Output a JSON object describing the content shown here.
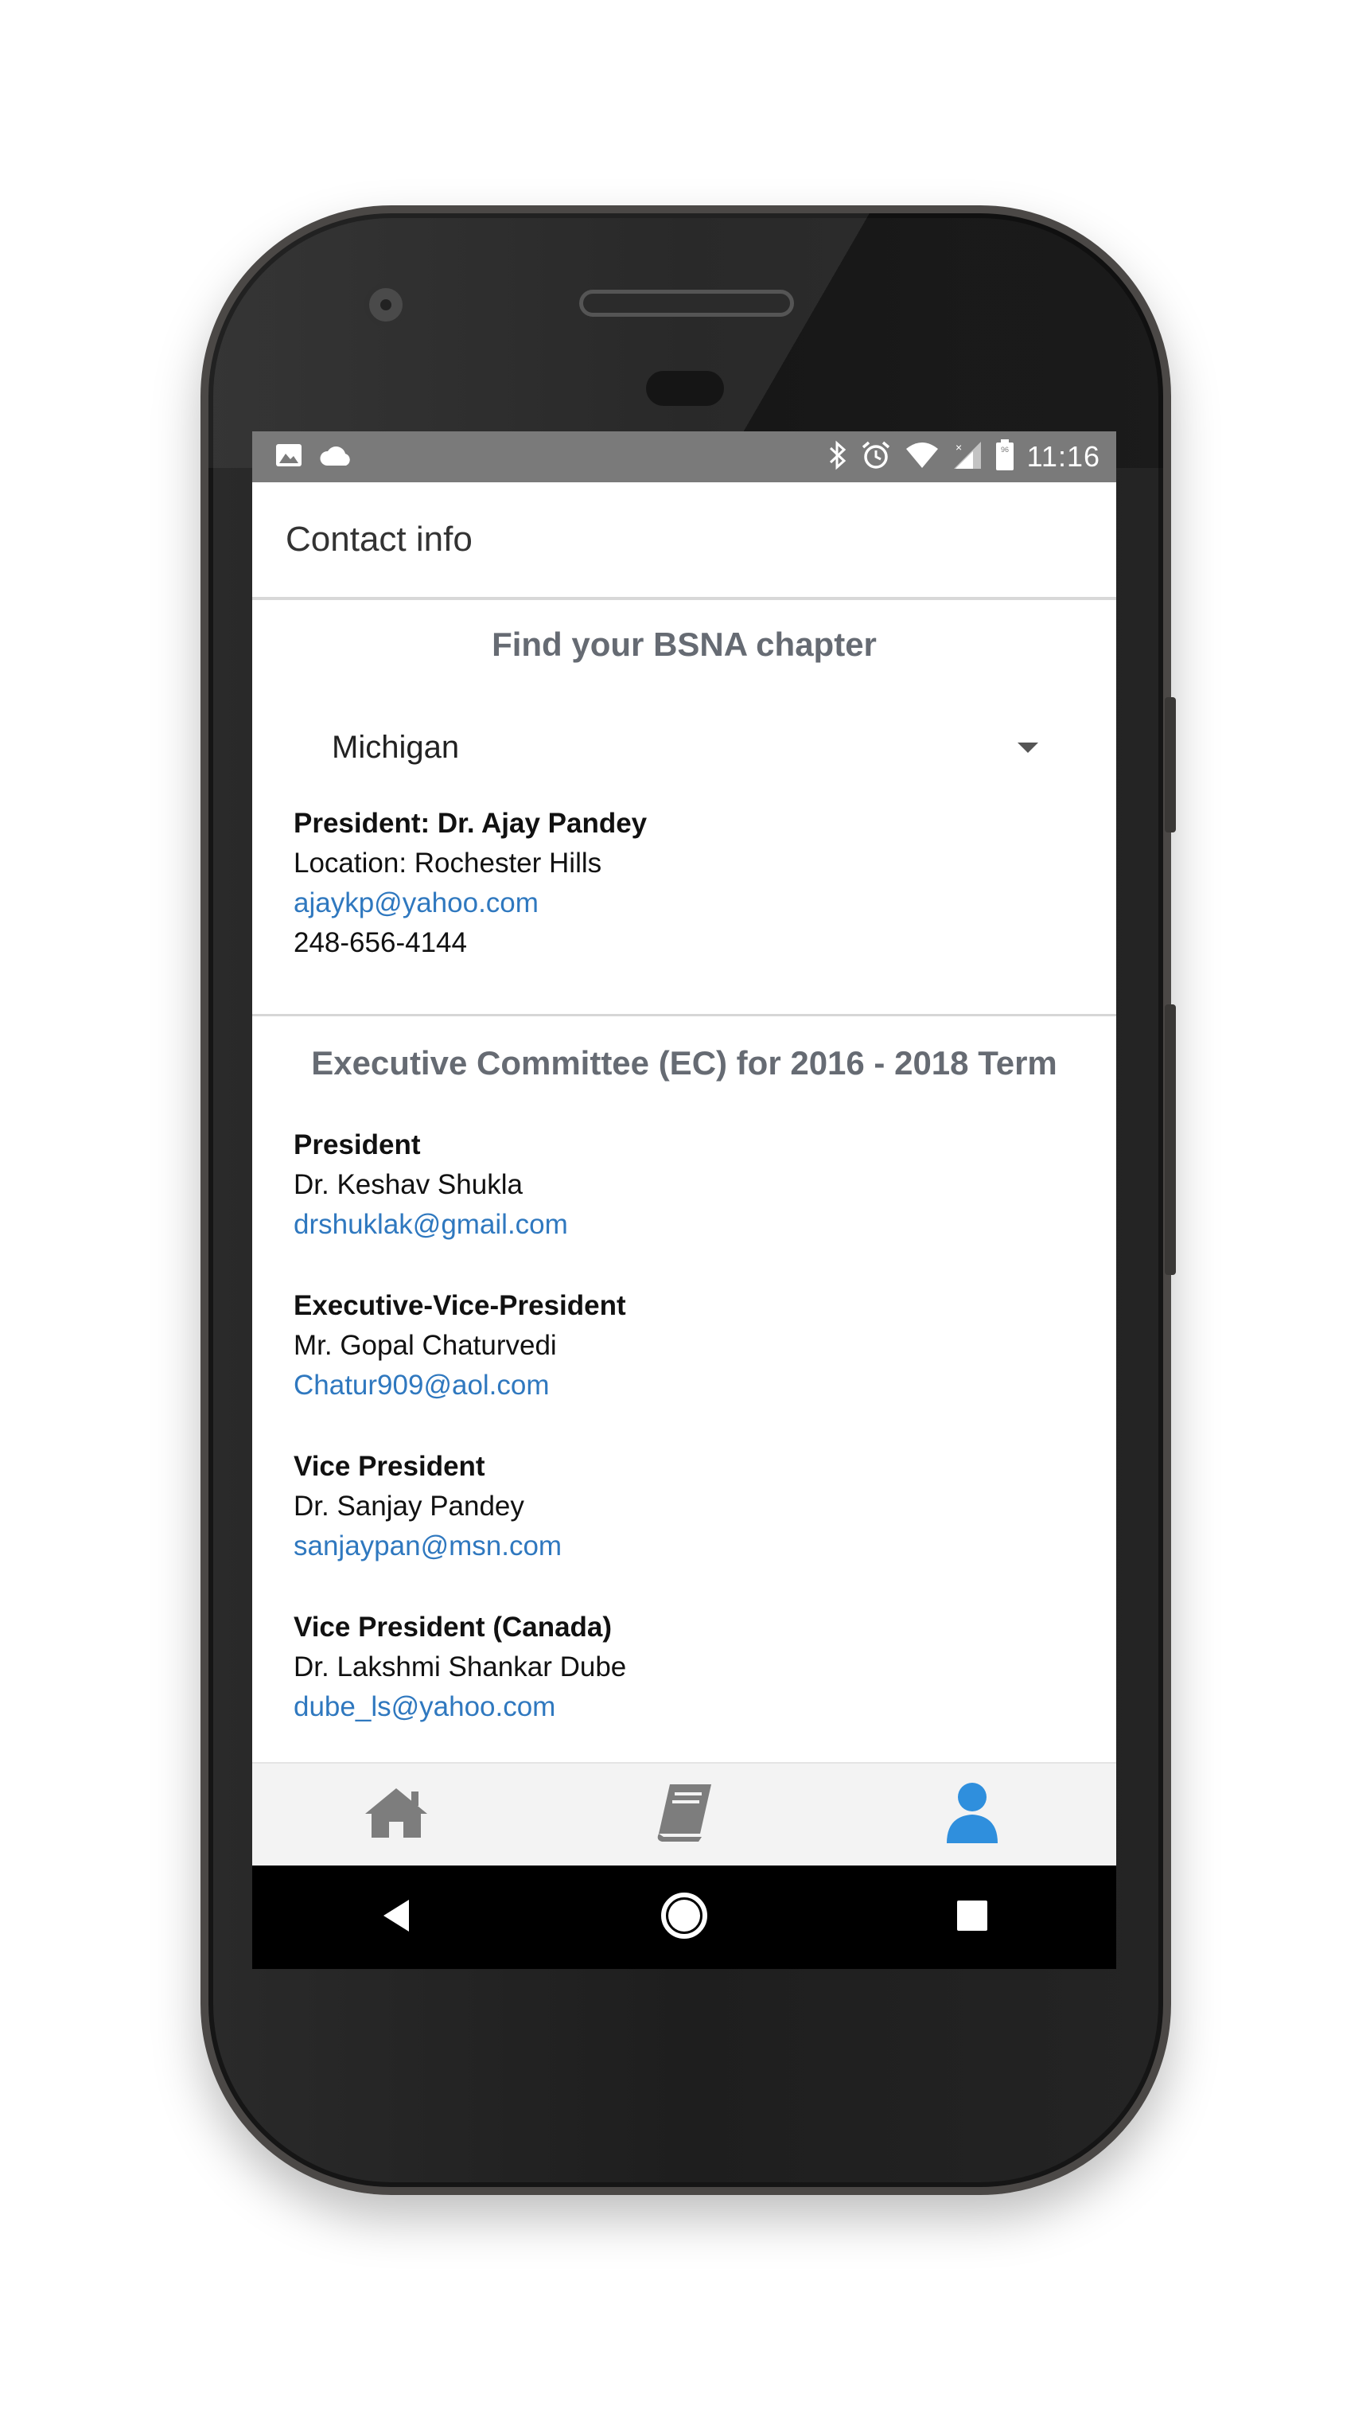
{
  "status_bar": {
    "time": "11:16",
    "battery_level": "96",
    "left_icons": [
      "image-icon",
      "cloud-icon"
    ],
    "right_icons": [
      "bluetooth-icon",
      "alarm-icon",
      "wifi-icon",
      "signal-icon",
      "battery-icon"
    ]
  },
  "app_bar": {
    "title": "Contact info"
  },
  "chapter": {
    "heading": "Find your BSNA chapter",
    "selected": "Michigan",
    "president": "President: Dr. Ajay Pandey",
    "location": "Location: Rochester Hills",
    "email": "ajaykp@yahoo.com",
    "phone": "248-656-4144"
  },
  "ec": {
    "heading": "Executive Committee (EC) for 2016 - 2018 Term",
    "members": [
      {
        "role": "President",
        "name": "Dr. Keshav Shukla",
        "email": "drshuklak@gmail.com"
      },
      {
        "role": "Executive-Vice-President",
        "name": "Mr. Gopal Chaturvedi",
        "email": "Chatur909@aol.com"
      },
      {
        "role": "Vice President",
        "name": "Dr. Sanjay Pandey",
        "email": "sanjaypan@msn.com"
      },
      {
        "role": "Vice President (Canada)",
        "name": "Dr. Lakshmi Shankar Dube",
        "email": "dube_ls@yahoo.com"
      }
    ]
  },
  "bottom_nav": {
    "items": [
      {
        "icon": "home-icon",
        "active": false
      },
      {
        "icon": "book-icon",
        "active": false
      },
      {
        "icon": "user-icon",
        "active": true
      }
    ],
    "active_color": "#2f8fdd",
    "inactive_color": "#7d7d7d"
  },
  "system_nav": {
    "items": [
      "back-icon",
      "home-circle-icon",
      "recents-icon"
    ]
  }
}
